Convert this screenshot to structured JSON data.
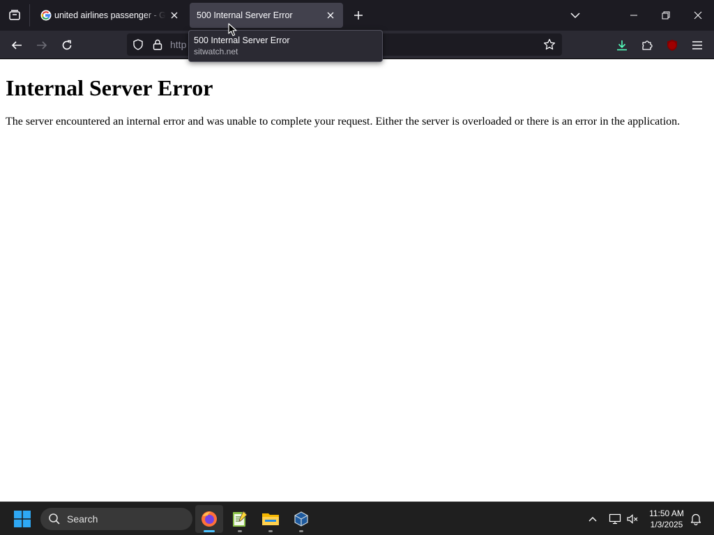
{
  "browser": {
    "tabs": [
      {
        "title": "united airlines passenger - Google Search",
        "active": false
      },
      {
        "title": "500 Internal Server Error",
        "active": true
      }
    ],
    "url_visible": "http",
    "tooltip": {
      "title": "500 Internal Server Error",
      "host": "sitwatch.net"
    },
    "extension_badge": "uO"
  },
  "page": {
    "heading": "Internal Server Error",
    "message": "The server encountered an internal error and was unable to complete your request. Either the server is overloaded or there is an error in the application."
  },
  "taskbar": {
    "search_label": "Search",
    "apps": [
      "firefox-icon",
      "notepad-icon",
      "file-explorer-icon",
      "virtualbox-icon"
    ],
    "time": "11:50 AM",
    "date": "1/3/2025"
  },
  "colors": {
    "tabstrip_bg": "#1c1b22",
    "toolbar_bg": "#2b2a33",
    "active_tab_bg": "#42414d",
    "download_accent": "#54ffbd",
    "taskbar_bg": "#1f1f1f",
    "taskbar_active": "#4cc2ff"
  }
}
